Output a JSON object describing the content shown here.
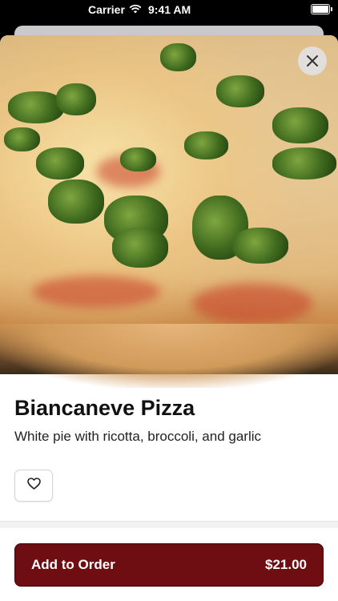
{
  "status_bar": {
    "carrier": "Carrier",
    "time": "9:41 AM"
  },
  "item": {
    "name": "Biancaneve Pizza",
    "description": "White pie with ricotta, broccoli, and garlic"
  },
  "order": {
    "button_label": "Add to Order",
    "price": "$21.00"
  },
  "colors": {
    "accent": "#6e0d12"
  },
  "icons": {
    "close": "close-icon",
    "favorite": "heart-icon",
    "wifi": "wifi-icon",
    "battery": "battery-icon"
  }
}
